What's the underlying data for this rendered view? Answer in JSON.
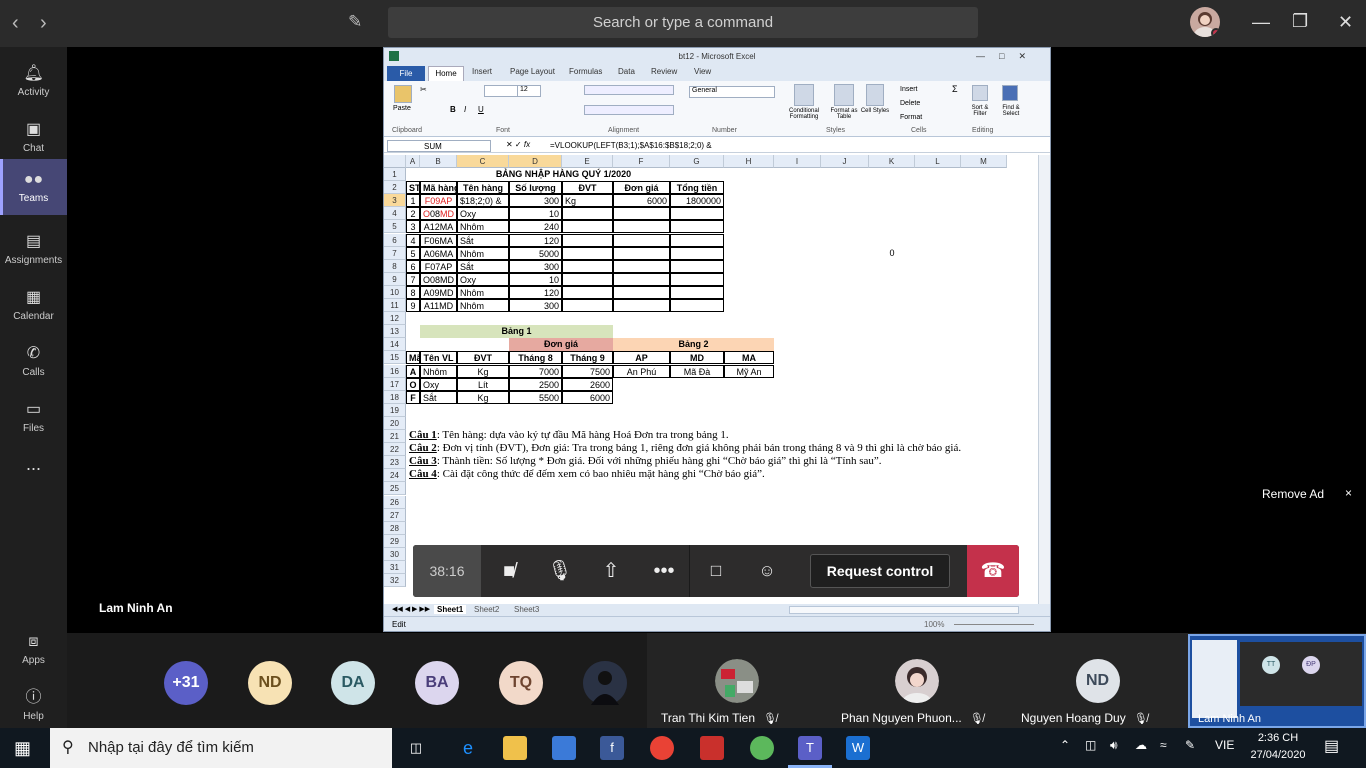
{
  "top_bar": {
    "back_icon": "chevron-left-icon",
    "forward_icon": "chevron-right-icon",
    "search_placeholder": "Search or type a command",
    "compose_icon": "compose-icon"
  },
  "rail": {
    "items": [
      {
        "label": "Activity",
        "icon": "bell-icon"
      },
      {
        "label": "Chat",
        "icon": "chat-icon"
      },
      {
        "label": "Teams",
        "icon": "teams-icon",
        "active": true
      },
      {
        "label": "Assignments",
        "icon": "backpack-icon"
      },
      {
        "label": "Calendar",
        "icon": "calendar-icon"
      },
      {
        "label": "Calls",
        "icon": "phone-icon"
      },
      {
        "label": "Files",
        "icon": "file-icon"
      },
      {
        "label": "...",
        "icon": "more-icon"
      },
      {
        "label": "Apps",
        "icon": "apps-icon"
      },
      {
        "label": "Help",
        "icon": "help-icon"
      }
    ]
  },
  "excel": {
    "window_title": "bt12 - Microsoft Excel",
    "tabs": [
      "File",
      "Home",
      "Insert",
      "Page Layout",
      "Formulas",
      "Data",
      "Review",
      "View"
    ],
    "ribbon_groups": [
      "Clipboard",
      "Font",
      "Alignment",
      "Number",
      "Styles",
      "Cells",
      "Editing"
    ],
    "ribbon_labels": {
      "paste": "Paste",
      "font_size": "12",
      "number_format": "General",
      "conditional": "Conditional Formatting",
      "format_table": "Format as Table",
      "cell_styles": "Cell Styles",
      "insert": "Insert",
      "delete": "Delete",
      "format": "Format",
      "sort": "Sort & Filter",
      "find": "Find & Select"
    },
    "name_box": "SUM",
    "formula": "=VLOOKUP(LEFT(B3;1);$A$16:$B$18;2;0) &",
    "columns": [
      "A",
      "B",
      "C",
      "D",
      "E",
      "F",
      "G",
      "H",
      "I",
      "J",
      "K",
      "L",
      "M"
    ],
    "title": "BẢNG NHẬP HÀNG QUÝ 1/2020",
    "headers": [
      "STT",
      "Mã hàng",
      "Tên hàng",
      "Số lượng",
      "ĐVT",
      "Đơn giá",
      "Tổng tiền"
    ],
    "rows": [
      {
        "stt": "1",
        "ma_a": "F09",
        "ma_b": "AP",
        "ten": "$18;2;0) &",
        "sl": "300",
        "dvt": "Kg",
        "dongia": "6000",
        "tong": "1800000"
      },
      {
        "stt": "2",
        "ma_a": "O08",
        "ma_b": "MD",
        "ten": "Oxy",
        "sl": "10",
        "dvt": "",
        "dongia": "",
        "tong": ""
      },
      {
        "stt": "3",
        "ma_a": "A12MA",
        "ma_b": "",
        "ten": "Nhôm",
        "sl": "240",
        "dvt": "",
        "dongia": "",
        "tong": ""
      },
      {
        "stt": "4",
        "ma_a": "F06MA",
        "ma_b": "",
        "ten": "Sắt",
        "sl": "120",
        "dvt": "",
        "dongia": "",
        "tong": ""
      },
      {
        "stt": "5",
        "ma_a": "A06MA",
        "ma_b": "",
        "ten": "Nhôm",
        "sl": "5000",
        "dvt": "",
        "dongia": "",
        "tong": ""
      },
      {
        "stt": "6",
        "ma_a": "F07AP",
        "ma_b": "",
        "ten": "Sắt",
        "sl": "300",
        "dvt": "",
        "dongia": "",
        "tong": ""
      },
      {
        "stt": "7",
        "ma_a": "O08MD",
        "ma_b": "",
        "ten": "Oxy",
        "sl": "10",
        "dvt": "",
        "dongia": "",
        "tong": ""
      },
      {
        "stt": "8",
        "ma_a": "A09MD",
        "ma_b": "",
        "ten": "Nhôm",
        "sl": "120",
        "dvt": "",
        "dongia": "",
        "tong": ""
      },
      {
        "stt": "9",
        "ma_a": "A11MD",
        "ma_b": "",
        "ten": "Nhôm",
        "sl": "300",
        "dvt": "",
        "dongia": "",
        "tong": ""
      }
    ],
    "k7_value": "0",
    "bang1": {
      "title": "Bảng 1",
      "group_header": "Đơn giá",
      "headers": [
        "Mã",
        "Tên VL",
        "ĐVT",
        "Tháng 8",
        "Tháng 9"
      ],
      "rows": [
        [
          "A",
          "Nhôm",
          "Kg",
          "7000",
          "7500"
        ],
        [
          "O",
          "Oxy",
          "Lít",
          "2500",
          "2600"
        ],
        [
          "F",
          "Sắt",
          "Kg",
          "5500",
          "6000"
        ]
      ]
    },
    "bang2": {
      "title": "Bảng 2",
      "headers": [
        "AP",
        "MD",
        "MA"
      ],
      "values": [
        "An Phú",
        "Mã Đà",
        "Mỹ An"
      ]
    },
    "questions": [
      {
        "label": "Câu 1",
        "text": ": Tên hàng: dựa vào ký tự đầu Mã hàng Hoá Đơn tra trong bảng 1."
      },
      {
        "label": "Câu 2",
        "text": ": Đơn vị tính (ĐVT), Đơn giá: Tra trong bảng 1, riêng đơn giá không phải bán trong tháng 8 và 9 thì ghi là chờ báo giá."
      },
      {
        "label": "Câu 3",
        "text": ": Thành tiền: Số lượng * Đơn giá. Đối với những phiếu hàng ghi “Chờ báo giá” thì ghi là “Tính sau”."
      },
      {
        "label": "Câu 4",
        "text": ": Cài đặt công thức để đếm xem có bao nhiêu mặt hàng ghi “Chờ báo giá”."
      }
    ],
    "sheet_tabs": [
      "Sheet1",
      "Sheet2",
      "Sheet3"
    ],
    "status_mode": "Edit",
    "zoom": "100%"
  },
  "call": {
    "timer": "38:16",
    "request_control": "Request control",
    "presenter_name": "Lam Ninh An",
    "remove_ad": "Remove Ad",
    "close_ad": "×"
  },
  "participants": {
    "bubbles": [
      {
        "text": "+31",
        "color": "#5b5fc7",
        "fg": "#ffffff"
      },
      {
        "text": "ND",
        "color": "#f7e2b4",
        "fg": "#6b4f1d"
      },
      {
        "text": "DA",
        "color": "#cfe4e8",
        "fg": "#2b5a63"
      },
      {
        "text": "BA",
        "color": "#dcd6ee",
        "fg": "#4a3e7a"
      },
      {
        "text": "TQ",
        "color": "#f2d9c9",
        "fg": "#6e4530"
      }
    ],
    "tiles": [
      {
        "name": "Tran Thi Kim Tien"
      },
      {
        "name": "Phan Nguyen Phuon..."
      },
      {
        "name": "Nguyen Hoang Duy",
        "initials": "ND"
      }
    ],
    "self_view_name": "Lam Ninh An",
    "self_badges": [
      "TT",
      "ĐP"
    ]
  },
  "taskbar": {
    "search_placeholder": "Nhập tại đây để tìm kiếm",
    "lang": "VIE",
    "time": "2:36 CH",
    "date": "27/04/2020"
  }
}
